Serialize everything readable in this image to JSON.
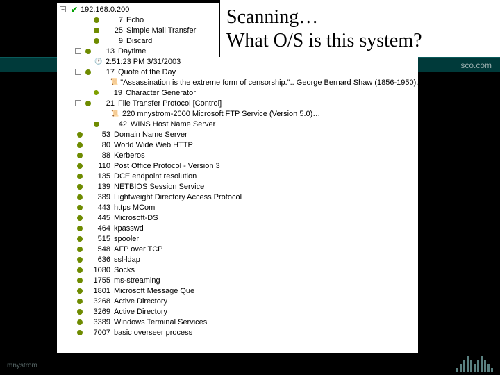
{
  "title": {
    "line1": "Scanning…",
    "line2": "What O/S is this system?"
  },
  "brand_strip": "sco.com",
  "footer_author": "mnystrom",
  "host": "192.168.0.200",
  "timestamp": "2:51:23 PM 3/31/2003",
  "quote": "\"Assassination is the extreme form of censorship.\".. George Bernard Shaw (1856-1950)..",
  "char_gen": {
    "port": "19",
    "name": "Character Generator"
  },
  "ftp_banner": "220 mnystrom-2000 Microsoft FTP Service (Version 5.0)…",
  "ports_top": [
    {
      "port": "7",
      "name": "Echo"
    },
    {
      "port": "25",
      "name": "Simple Mail Transfer"
    },
    {
      "port": "9",
      "name": "Discard"
    },
    {
      "port": "13",
      "name": "Daytime"
    }
  ],
  "port_quote": {
    "port": "17",
    "name": "Quote of the Day"
  },
  "port_ftp": {
    "port": "21",
    "name": "File Transfer Protocol [Control]"
  },
  "ports_rest": [
    {
      "port": "42",
      "name": "WINS Host Name Server"
    },
    {
      "port": "53",
      "name": "Domain Name Server"
    },
    {
      "port": "80",
      "name": "World Wide Web HTTP"
    },
    {
      "port": "88",
      "name": "Kerberos"
    },
    {
      "port": "110",
      "name": "Post Office Protocol - Version 3"
    },
    {
      "port": "135",
      "name": "DCE endpoint resolution"
    },
    {
      "port": "139",
      "name": "NETBIOS Session Service"
    },
    {
      "port": "389",
      "name": "Lightweight Directory Access Protocol"
    },
    {
      "port": "443",
      "name": "https MCom"
    },
    {
      "port": "445",
      "name": "Microsoft-DS"
    },
    {
      "port": "464",
      "name": "kpasswd"
    },
    {
      "port": "515",
      "name": "spooler"
    },
    {
      "port": "548",
      "name": "AFP over TCP"
    },
    {
      "port": "636",
      "name": "ssl-ldap"
    },
    {
      "port": "1080",
      "name": "Socks"
    },
    {
      "port": "1755",
      "name": "ms-streaming"
    },
    {
      "port": "1801",
      "name": "Microsoft Message Que"
    },
    {
      "port": "3268",
      "name": "Active Directory"
    },
    {
      "port": "3269",
      "name": "Active Directory"
    },
    {
      "port": "3389",
      "name": "Windows Terminal Services"
    },
    {
      "port": "7007",
      "name": "basic overseer process"
    }
  ]
}
